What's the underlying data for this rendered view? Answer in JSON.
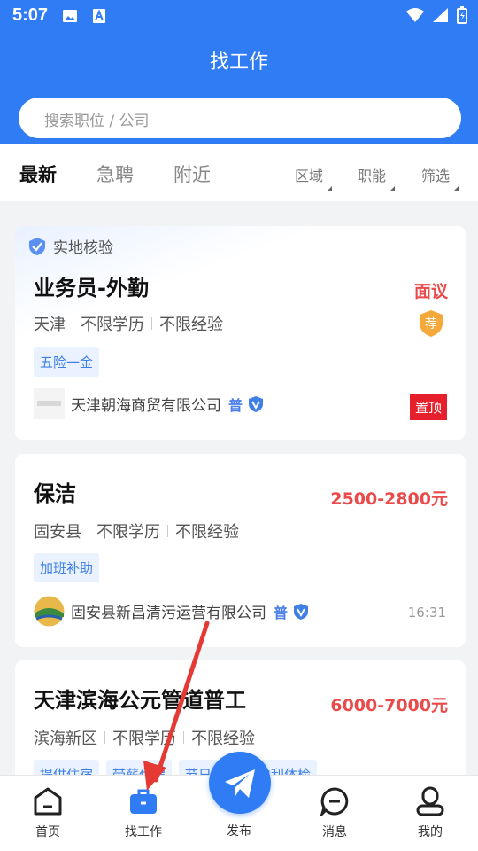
{
  "status_bar": {
    "time": "5:07"
  },
  "header": {
    "title": "找工作"
  },
  "search": {
    "placeholder": "搜索职位 / 公司"
  },
  "tabs": [
    {
      "label": "最新",
      "active": true
    },
    {
      "label": "急聘",
      "active": false
    },
    {
      "label": "附近",
      "active": false
    }
  ],
  "filters": [
    {
      "label": "区域"
    },
    {
      "label": "职能"
    },
    {
      "label": "筛选"
    }
  ],
  "jobs": [
    {
      "verified_label": "实地核验",
      "title": "业务员-外勤",
      "salary": "面议",
      "location": "天津",
      "education": "不限学历",
      "experience": "不限经验",
      "tags": [
        "五险一金"
      ],
      "company": "天津朝海商贸有限公司",
      "pu_badge": "普",
      "recommend_badge": "荐",
      "pin_label": "置顶"
    },
    {
      "title": "保洁",
      "salary": "2500-2800元",
      "location": "固安县",
      "education": "不限学历",
      "experience": "不限经验",
      "tags": [
        "加班补助"
      ],
      "company": "固安县新昌清污运营有限公司",
      "pu_badge": "普",
      "time": "16:31"
    },
    {
      "title": "天津滨海公元管道普工",
      "salary": "6000-7000元",
      "location": "滨海新区",
      "education": "不限学历",
      "experience": "不限经验",
      "tags": [
        "提供住宿",
        "带薪休假",
        "节日福利",
        "福利体检"
      ]
    }
  ],
  "bottom_nav": [
    {
      "label": "首页",
      "icon": "home-icon"
    },
    {
      "label": "找工作",
      "icon": "briefcase-icon",
      "active": true
    },
    {
      "label": "发布",
      "icon": "send-icon"
    },
    {
      "label": "消息",
      "icon": "message-icon"
    },
    {
      "label": "我的",
      "icon": "profile-icon"
    }
  ],
  "colors": {
    "primary": "#2f7cf4",
    "salary": "#e94a4a",
    "pin": "#e5202c",
    "annotation_arrow": "#e53935"
  }
}
